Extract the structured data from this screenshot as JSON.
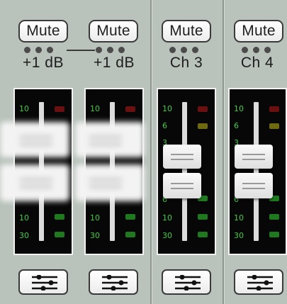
{
  "strips": [
    {
      "id": "ch1",
      "mute_label": "Mute",
      "label": "+1 dB",
      "linked": true
    },
    {
      "id": "ch2",
      "mute_label": "Mute",
      "label": "+1 dB",
      "linked": true
    },
    {
      "id": "ch3",
      "mute_label": "Mute",
      "label": "Ch 3",
      "linked": false
    },
    {
      "id": "ch4",
      "mute_label": "Mute",
      "label": "Ch 4",
      "linked": false
    }
  ],
  "scale": [
    "10",
    "6",
    "3",
    "0",
    "3",
    "6",
    "10",
    "30"
  ],
  "colors": {
    "led_green": "#1f7a1f",
    "led_yellow": "#6f6a10",
    "led_red": "#6a1010",
    "scale_text": "#44cc44",
    "panel_bg": "#070707",
    "strip_bg": "#b9c2bb"
  },
  "icons": {
    "eq": "eq-sliders-icon"
  }
}
